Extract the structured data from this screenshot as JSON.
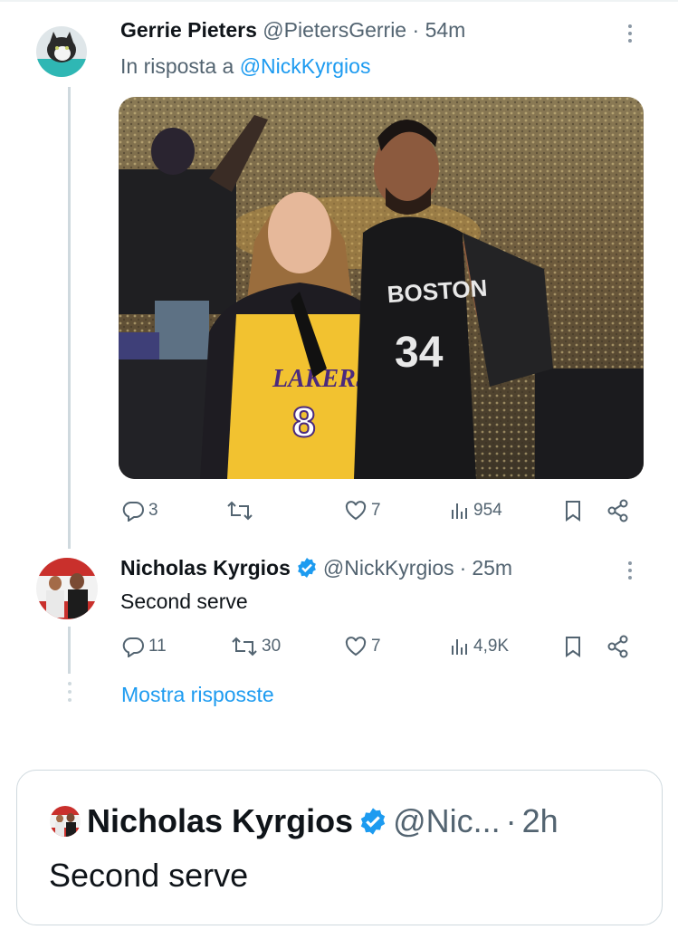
{
  "tweet1": {
    "display_name": "Gerrie Pieters",
    "handle": "@PietersGerrie",
    "separator": "·",
    "time": "54m",
    "reply_prefix": "In risposta a",
    "reply_to": "@NickKyrgios",
    "image_text": {
      "jersey_left_team": "LAKERS",
      "jersey_left_number": "8",
      "jersey_right_team": "BOSTON",
      "jersey_right_number": "34"
    },
    "stats": {
      "replies": "3",
      "retweets": "",
      "likes": "7",
      "views": "954"
    }
  },
  "tweet2": {
    "display_name": "Nicholas Kyrgios",
    "handle": "@NickKyrgios",
    "separator": "·",
    "time": "25m",
    "text": "Second serve",
    "stats": {
      "replies": "11",
      "retweets": "30",
      "likes": "7",
      "views": "4,9K"
    },
    "show_replies": "Mostra risposste"
  },
  "quote": {
    "display_name": "Nicholas Kyrgios",
    "handle": "@Nic...",
    "separator": "·",
    "time": "2h",
    "text": "Second serve"
  },
  "colors": {
    "link_blue": "#1d9bf0",
    "verified_blue": "#1d9bf0",
    "muted": "#536471",
    "thread_line": "#cfd9de"
  },
  "icons": [
    "reply-icon",
    "retweet-icon",
    "like-icon",
    "views-icon",
    "bookmark-icon",
    "share-icon",
    "verified-badge-icon",
    "more-icon"
  ]
}
